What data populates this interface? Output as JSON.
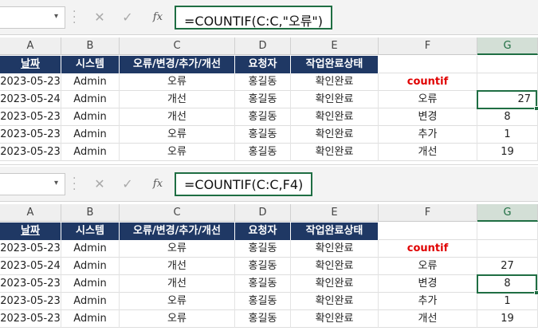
{
  "top": {
    "formula": "=COUNTIF(C:C,\"오류\")",
    "fx_label": "fx",
    "selected_column": "G",
    "selected_row": 1,
    "columns": [
      "A",
      "B",
      "C",
      "D",
      "E",
      "F",
      "G"
    ],
    "table_header": [
      "날짜",
      "시스템",
      "오류/변경/추가/개선",
      "요청자",
      "작업완료상태"
    ],
    "rows": [
      [
        "2023-05-23",
        "Admin",
        "오류",
        "홍길동",
        "확인완료",
        "countif",
        ""
      ],
      [
        "2023-05-24",
        "Admin",
        "개선",
        "홍길동",
        "확인완료",
        "오류",
        "27"
      ],
      [
        "2023-05-23",
        "Admin",
        "개선",
        "홍길동",
        "확인완료",
        "변경",
        "8"
      ],
      [
        "2023-05-23",
        "Admin",
        "오류",
        "홍길동",
        "확인완료",
        "추가",
        "1"
      ],
      [
        "2023-05-23",
        "Admin",
        "오류",
        "홍길동",
        "확인완료",
        "개선",
        "19"
      ]
    ]
  },
  "bottom": {
    "formula": "=COUNTIF(C:C,F4)",
    "fx_label": "fx",
    "selected_column": "G",
    "selected_row": 2,
    "columns": [
      "A",
      "B",
      "C",
      "D",
      "E",
      "F",
      "G"
    ],
    "table_header": [
      "날짜",
      "시스템",
      "오류/변경/추가/개선",
      "요청자",
      "작업완료상태"
    ],
    "rows": [
      [
        "2023-05-23",
        "Admin",
        "오류",
        "홍길동",
        "확인완료",
        "countif",
        ""
      ],
      [
        "2023-05-24",
        "Admin",
        "개선",
        "홍길동",
        "확인완료",
        "오류",
        "27"
      ],
      [
        "2023-05-23",
        "Admin",
        "개선",
        "홍길동",
        "확인완료",
        "변경",
        "8"
      ],
      [
        "2023-05-23",
        "Admin",
        "오류",
        "홍길동",
        "확인완료",
        "추가",
        "1"
      ],
      [
        "2023-05-23",
        "Admin",
        "오류",
        "홍길동",
        "확인완료",
        "개선",
        "19"
      ]
    ]
  },
  "icons": {
    "name_box_dropdown": "chevron-down-icon",
    "cancel": "close-icon",
    "enter": "check-icon",
    "insert_function": "fx-icon"
  },
  "colors": {
    "table_header_bg": "#1f3864",
    "selection": "#1f6e43",
    "countif_label": "#e00000"
  }
}
